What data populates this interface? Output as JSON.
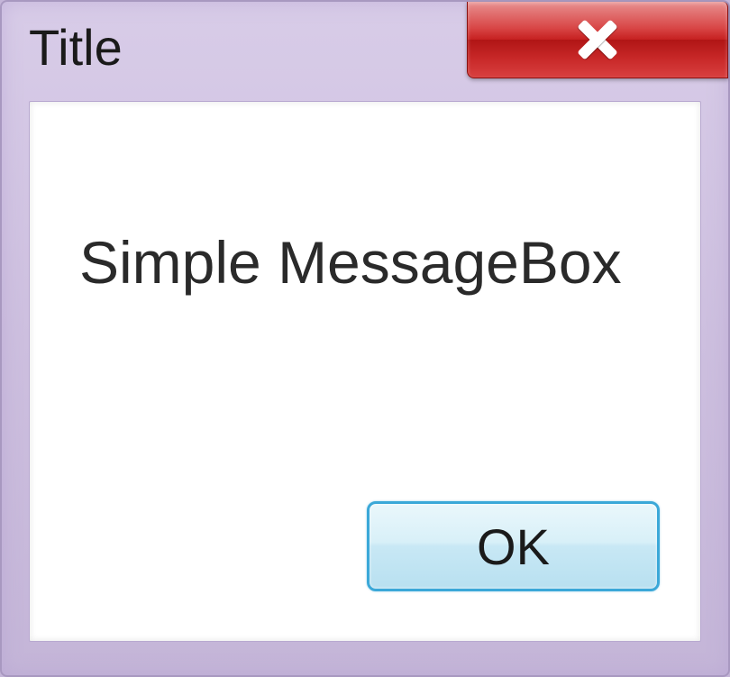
{
  "window": {
    "title": "Title",
    "message": "Simple MessageBox",
    "buttons": {
      "ok_label": "OK"
    }
  }
}
